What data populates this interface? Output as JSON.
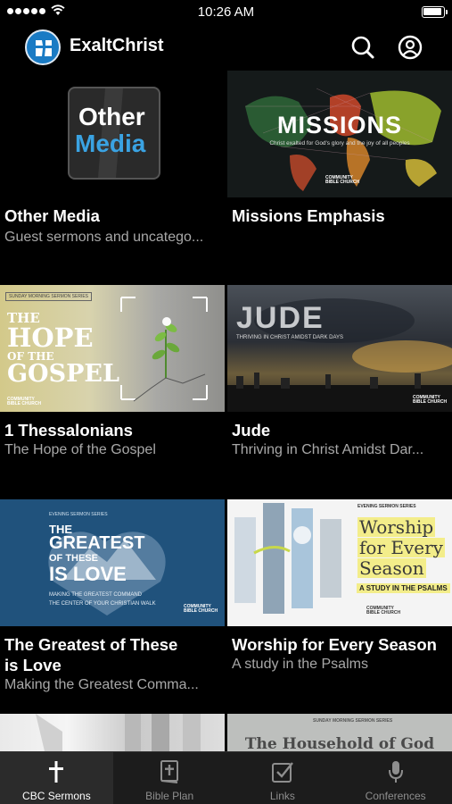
{
  "status_bar": {
    "time": "10:26 AM"
  },
  "header": {
    "app_title": "ExaltChrist"
  },
  "tiles": [
    {
      "title": "Other Media",
      "subtitle": "Guest sermons and uncatego...",
      "thumb_text": [
        "Other",
        "Media"
      ]
    },
    {
      "title": "Missions Emphasis",
      "subtitle": "",
      "thumb_text": [
        "MISSIONS",
        "Christ exalted for God's glory and the joy of all peoples"
      ]
    },
    {
      "title": "1 Thessalonians",
      "subtitle": "The Hope of the Gospel",
      "thumb_text": [
        "THE",
        "HOPE",
        "OF THE",
        "GOSPEL",
        "SUNDAY MORNING SERMON SERIES"
      ]
    },
    {
      "title": "Jude",
      "subtitle": "Thriving in Christ Amidst Dar...",
      "thumb_text": [
        "JUDE",
        "THRIVING IN CHRIST AMIDST DARK DAYS"
      ]
    },
    {
      "title": "The Greatest of These\nis Love",
      "subtitle": "Making the Greatest Comma...",
      "thumb_text": [
        "THE",
        "GREATEST",
        "OF THESE",
        "IS LOVE",
        "MAKING THE GREATEST COMMAND",
        "THE CENTER OF YOUR CHRISTIAN WALK",
        "EVENING SERMON SERIES"
      ]
    },
    {
      "title": "Worship for Every Season",
      "subtitle": "A study in the Psalms",
      "thumb_text": [
        "Worship",
        "for Every",
        "Season",
        "A STUDY IN THE PSALMS",
        "EVENING SERMON SERIES"
      ]
    },
    {
      "title": "",
      "subtitle": "",
      "thumb_text": []
    },
    {
      "title": "",
      "subtitle": "",
      "thumb_text": [
        "The Household of God",
        "SUNDAY MORNING SERMON SERIES"
      ]
    }
  ],
  "brand_small": [
    "COMMUNITY",
    "BIBLE CHURCH"
  ],
  "tabbar": {
    "tabs": [
      {
        "label": "CBC Sermons",
        "icon": "cross-icon",
        "active": true
      },
      {
        "label": "Bible Plan",
        "icon": "bible-icon",
        "active": false
      },
      {
        "label": "Links",
        "icon": "checkbox-icon",
        "active": false
      },
      {
        "label": "Conferences",
        "icon": "microphone-icon",
        "active": false
      }
    ]
  },
  "colors": {
    "accent_blue": "#3aa3e3",
    "logo_blue": "#1a7bc4",
    "tab_active_bg": "#2b2b2b",
    "worship_highlight": "#f3ed8a"
  }
}
